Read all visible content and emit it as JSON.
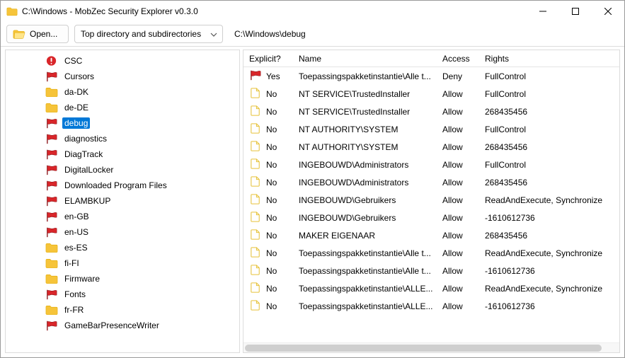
{
  "window": {
    "title": "C:\\Windows - MobZec Security Explorer v0.3.0"
  },
  "toolbar": {
    "open_label": "Open...",
    "scope_selected": "Top directory and subdirectories",
    "path": "C:\\Windows\\debug"
  },
  "tree": [
    {
      "icon": "alert",
      "label": "CSC",
      "selected": false
    },
    {
      "icon": "flag",
      "label": "Cursors",
      "selected": false
    },
    {
      "icon": "folder",
      "label": "da-DK",
      "selected": false
    },
    {
      "icon": "folder",
      "label": "de-DE",
      "selected": false
    },
    {
      "icon": "flag",
      "label": "debug",
      "selected": true
    },
    {
      "icon": "flag",
      "label": "diagnostics",
      "selected": false
    },
    {
      "icon": "flag",
      "label": "DiagTrack",
      "selected": false
    },
    {
      "icon": "flag",
      "label": "DigitalLocker",
      "selected": false
    },
    {
      "icon": "flag",
      "label": "Downloaded Program Files",
      "selected": false
    },
    {
      "icon": "flag",
      "label": "ELAMBKUP",
      "selected": false
    },
    {
      "icon": "flag",
      "label": "en-GB",
      "selected": false
    },
    {
      "icon": "flag",
      "label": "en-US",
      "selected": false
    },
    {
      "icon": "folder",
      "label": "es-ES",
      "selected": false
    },
    {
      "icon": "folder",
      "label": "fi-FI",
      "selected": false
    },
    {
      "icon": "folder",
      "label": "Firmware",
      "selected": false
    },
    {
      "icon": "flag",
      "label": "Fonts",
      "selected": false
    },
    {
      "icon": "folder",
      "label": "fr-FR",
      "selected": false
    },
    {
      "icon": "flag",
      "label": "GameBarPresenceWriter",
      "selected": false
    }
  ],
  "grid": {
    "headers": {
      "explicit": "Explicit?",
      "name": "Name",
      "access": "Access",
      "rights": "Rights"
    },
    "rows": [
      {
        "icon": "flag",
        "explicit": "Yes",
        "name": "Toepassingspakketinstantie\\Alle t...",
        "access": "Deny",
        "rights": "FullControl"
      },
      {
        "icon": "file",
        "explicit": "No",
        "name": "NT SERVICE\\TrustedInstaller",
        "access": "Allow",
        "rights": "FullControl"
      },
      {
        "icon": "file",
        "explicit": "No",
        "name": "NT SERVICE\\TrustedInstaller",
        "access": "Allow",
        "rights": "268435456"
      },
      {
        "icon": "file",
        "explicit": "No",
        "name": "NT AUTHORITY\\SYSTEM",
        "access": "Allow",
        "rights": "FullControl"
      },
      {
        "icon": "file",
        "explicit": "No",
        "name": "NT AUTHORITY\\SYSTEM",
        "access": "Allow",
        "rights": "268435456"
      },
      {
        "icon": "file",
        "explicit": "No",
        "name": "INGEBOUWD\\Administrators",
        "access": "Allow",
        "rights": "FullControl"
      },
      {
        "icon": "file",
        "explicit": "No",
        "name": "INGEBOUWD\\Administrators",
        "access": "Allow",
        "rights": "268435456"
      },
      {
        "icon": "file",
        "explicit": "No",
        "name": "INGEBOUWD\\Gebruikers",
        "access": "Allow",
        "rights": "ReadAndExecute, Synchronize"
      },
      {
        "icon": "file",
        "explicit": "No",
        "name": "INGEBOUWD\\Gebruikers",
        "access": "Allow",
        "rights": "-1610612736"
      },
      {
        "icon": "file",
        "explicit": "No",
        "name": "MAKER EIGENAAR",
        "access": "Allow",
        "rights": "268435456"
      },
      {
        "icon": "file",
        "explicit": "No",
        "name": "Toepassingspakketinstantie\\Alle t...",
        "access": "Allow",
        "rights": "ReadAndExecute, Synchronize"
      },
      {
        "icon": "file",
        "explicit": "No",
        "name": "Toepassingspakketinstantie\\Alle t...",
        "access": "Allow",
        "rights": "-1610612736"
      },
      {
        "icon": "file",
        "explicit": "No",
        "name": "Toepassingspakketinstantie\\ALLE...",
        "access": "Allow",
        "rights": "ReadAndExecute, Synchronize"
      },
      {
        "icon": "file",
        "explicit": "No",
        "name": "Toepassingspakketinstantie\\ALLE...",
        "access": "Allow",
        "rights": "-1610612736"
      }
    ]
  },
  "colors": {
    "flag_red": "#d9262a",
    "alert_red": "#d9262a",
    "folder_yellow": "#f6c43a",
    "folder_shadow": "#e0a800",
    "file_outline": "#e6c23a",
    "selection": "#0078d7"
  }
}
